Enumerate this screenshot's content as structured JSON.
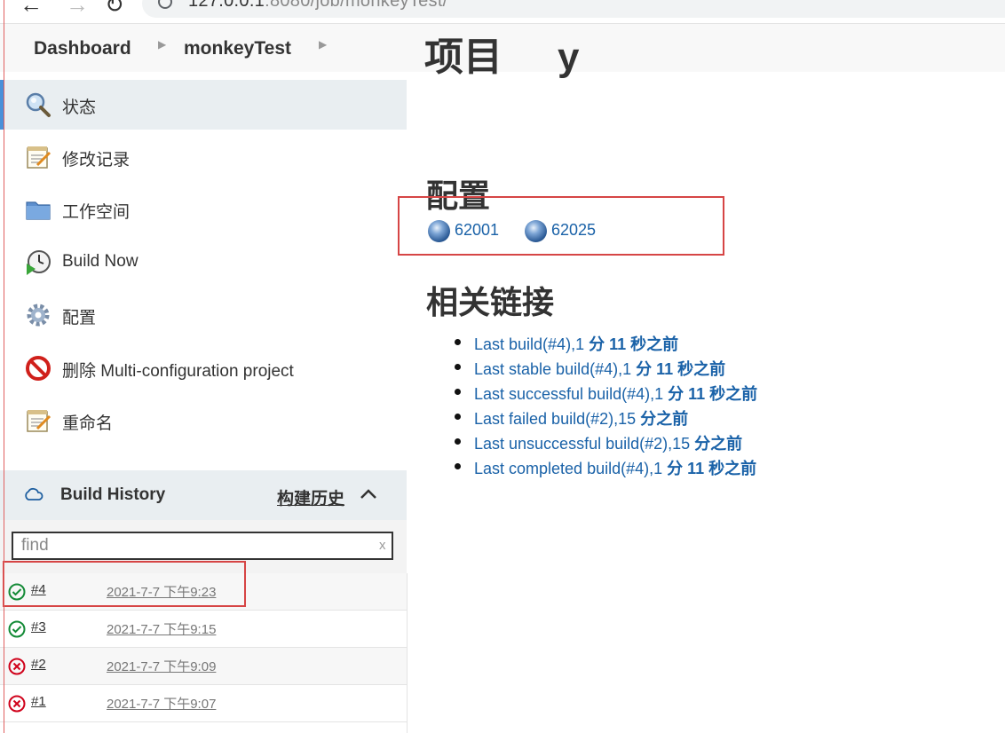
{
  "browser": {
    "url_host": "127.0.0.1",
    "url_rest": ":8080/job/monkeyTest/"
  },
  "breadcrumb": {
    "items": [
      "Dashboard",
      "monkeyTest"
    ]
  },
  "sidebar": {
    "items": [
      {
        "label": "状态",
        "icon": "search-icon"
      },
      {
        "label": "修改记录",
        "icon": "notepad-icon"
      },
      {
        "label": "工作空间",
        "icon": "folder-icon"
      },
      {
        "label": "Build Now",
        "icon": "clock-play-icon"
      },
      {
        "label": "配置",
        "icon": "gear-icon"
      },
      {
        "label": "删除 Multi-configuration project",
        "icon": "no-entry-icon"
      },
      {
        "label": "重命名",
        "icon": "notepad-icon"
      }
    ]
  },
  "build_history": {
    "title": "Build History",
    "trend_link": "构建历史",
    "find_placeholder": "find",
    "clear_label": "x",
    "builds": [
      {
        "number": "#4",
        "time": "2021-7-7 下午9:23",
        "status": "success"
      },
      {
        "number": "#3",
        "time": "2021-7-7 下午9:15",
        "status": "success"
      },
      {
        "number": "#2",
        "time": "2021-7-7 下午9:09",
        "status": "failed"
      },
      {
        "number": "#1",
        "time": "2021-7-7 下午9:07",
        "status": "failed"
      }
    ]
  },
  "main": {
    "config_heading": "配置",
    "configurations": [
      "62001",
      "62025"
    ],
    "links_heading": "相关链接",
    "links": [
      {
        "text": "Last build(#4),1 ",
        "bold": "分 11 秒之前"
      },
      {
        "text": "Last stable build(#4),1 ",
        "bold": "分 11 秒之前"
      },
      {
        "text": "Last successful build(#4),1 ",
        "bold": "分 11 秒之前"
      },
      {
        "text": "Last failed build(#2),15 ",
        "bold": "分之前"
      },
      {
        "text": "Last unsuccessful build(#2),15 ",
        "bold": "分之前"
      },
      {
        "text": "Last completed build(#4),1 ",
        "bold": "分 11 秒之前"
      }
    ]
  },
  "colors": {
    "link": "#1a62a8",
    "success": "#138a36",
    "failed": "#d0021b",
    "highlight": "#d64545"
  }
}
